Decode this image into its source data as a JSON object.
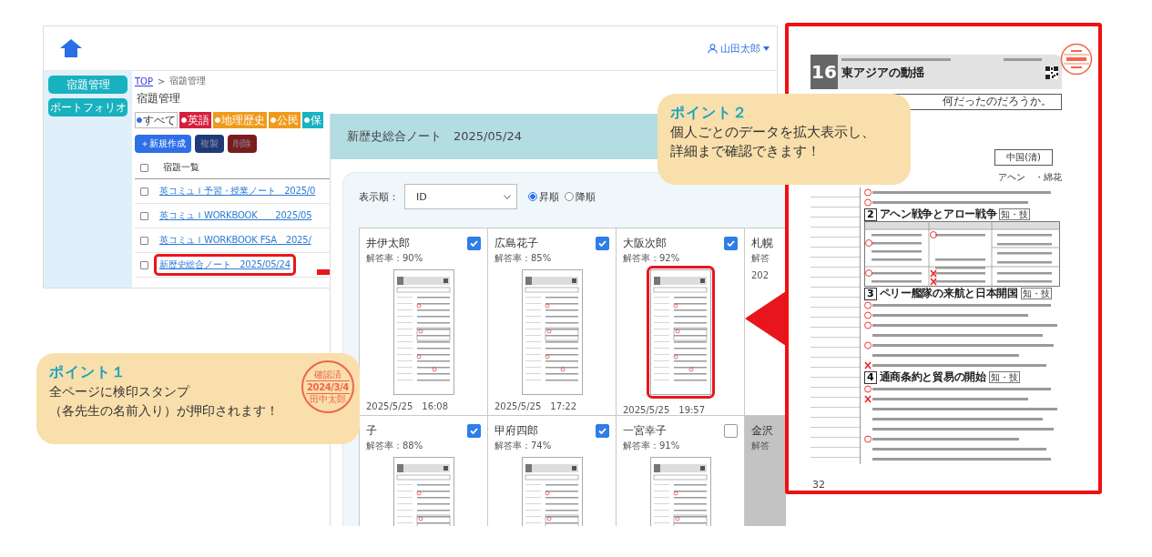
{
  "app_window": {
    "user_name": "山田太郎",
    "sidebar": [
      {
        "label": "宿題管理"
      },
      {
        "label": "ポートフォリオ"
      }
    ],
    "breadcrumb": {
      "link": "TOP",
      "separator": ">",
      "current": "宿題管理"
    },
    "title": "宿題管理",
    "filters": [
      {
        "label": "すべて",
        "color": "#ffffff",
        "selected": true
      },
      {
        "label": "英語",
        "color": "#d61f3c",
        "selected": false
      },
      {
        "label": "地理歴史",
        "color": "#f09a1c",
        "selected": false
      },
      {
        "label": "公民",
        "color": "#f09a1c",
        "selected": false
      },
      {
        "label": "保",
        "color": "#19b3c1",
        "selected": false
      }
    ],
    "actions": [
      {
        "label": "＋新規作成",
        "color": "#2f6fe8",
        "disabled": false
      },
      {
        "label": "複製",
        "color": "#1f3a78",
        "disabled": true
      },
      {
        "label": "削除",
        "color": "#7a1c1c",
        "disabled": true
      }
    ],
    "list_header": "宿題一覧",
    "all_checked": false,
    "assignments": [
      {
        "title": "英コミュＩ予習・授業ノート　2025/0",
        "checked": false,
        "highlighted": false
      },
      {
        "title": "英コミュＩWORKBOOK　　2025/05",
        "checked": false,
        "highlighted": false
      },
      {
        "title": "英コミュＩWORKBOOK FSA　2025/",
        "checked": false,
        "highlighted": false
      },
      {
        "title": "新歴史総合ノート　2025/05/24",
        "checked": false,
        "highlighted": true
      }
    ]
  },
  "detail_panel": {
    "title": "新歴史総合ノート　2025/05/24",
    "sort_label": "表示順：",
    "sort_value": "ID",
    "order": [
      {
        "label": "昇順",
        "selected": true
      },
      {
        "label": "降順",
        "selected": false
      }
    ],
    "students": [
      {
        "name": "井伊太郎",
        "checked": true,
        "rate": "解答率：90%",
        "date": "2025/5/25　16:08",
        "submitted": true,
        "highlighted": false
      },
      {
        "name": "広島花子",
        "checked": true,
        "rate": "解答率：85%",
        "date": "2025/5/25　17:22",
        "submitted": true,
        "highlighted": false
      },
      {
        "name": "大阪次郎",
        "checked": true,
        "rate": "解答率：92%",
        "date": "2025/5/25　19:57",
        "submitted": true,
        "highlighted": true
      },
      {
        "name": "札幌",
        "rate": "解答",
        "date": "202",
        "submitted": true
      },
      {
        "name": "子",
        "checked": true,
        "rate": "解答率：88%",
        "submitted": true,
        "highlighted": false
      },
      {
        "name": "甲府四郎",
        "checked": true,
        "rate": "解答率：74%",
        "submitted": true,
        "highlighted": false
      },
      {
        "name": "一宮幸子",
        "checked": false,
        "rate": "解答率：91%",
        "submitted": true,
        "highlighted": false
      },
      {
        "name": "金沢",
        "rate": "解答",
        "submitted": false
      }
    ]
  },
  "worksheet": {
    "number": "16",
    "title": "東アジアの動揺",
    "question": "何だったのだろうか。",
    "diagram_box": "中国(清)",
    "diagram_text": "アヘン　・綿花",
    "sections": [
      {
        "number": "2",
        "text": "アヘン戦争とアロー戦争",
        "tag": "知・技"
      },
      {
        "number": "3",
        "text": "ペリー艦隊の来航と日本開国",
        "tag": "知・技"
      },
      {
        "number": "4",
        "text": "通商条約と貿易の開始",
        "tag": "知・技"
      }
    ],
    "page": "32"
  },
  "callouts": [
    {
      "heading": "ポイント１",
      "lines": [
        "全ページに検印スタンプ",
        "（各先生の名前入り）が押印されます！"
      ],
      "stamp": {
        "top": "確認済",
        "date": "2024/3/4",
        "name": "田中太郎"
      }
    },
    {
      "heading": "ポイント２",
      "lines": [
        "個人ごとのデータを拡大表示し、",
        "詳細まで確認できます！"
      ]
    }
  ]
}
